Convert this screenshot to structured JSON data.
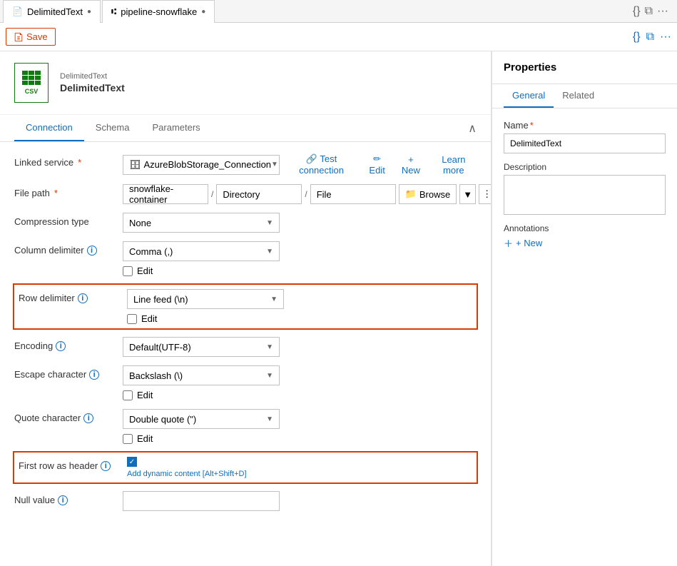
{
  "tabs": [
    {
      "id": "delimited-text",
      "label": "DelimitedText",
      "icon": "file-icon",
      "active": true
    },
    {
      "id": "pipeline-snowflake",
      "label": "pipeline-snowflake",
      "icon": "pipeline-icon",
      "active": false
    }
  ],
  "toolbar": {
    "save_label": "Save",
    "save_icon": "save-icon"
  },
  "dataset": {
    "type": "DelimitedText",
    "name": "DelimitedText"
  },
  "section_tabs": [
    {
      "id": "connection",
      "label": "Connection",
      "active": true
    },
    {
      "id": "schema",
      "label": "Schema",
      "active": false
    },
    {
      "id": "parameters",
      "label": "Parameters",
      "active": false
    }
  ],
  "form": {
    "linked_service_label": "Linked service",
    "linked_service_value": "AzureBlobStorage_Connection",
    "test_connection": "Test connection",
    "edit_label": "Edit",
    "new_label": "+ New",
    "learn_more": "Learn more",
    "file_path_label": "File path",
    "file_path_container": "snowflake-container",
    "file_path_directory": "Directory",
    "file_path_file": "File",
    "browse_label": "Browse",
    "compression_type_label": "Compression type",
    "compression_type_value": "None",
    "column_delimiter_label": "Column delimiter",
    "column_delimiter_info": "i",
    "column_delimiter_value": "Comma (,)",
    "column_edit_label": "Edit",
    "row_delimiter_label": "Row delimiter",
    "row_delimiter_info": "i",
    "row_delimiter_value": "Line feed (\\n)",
    "row_edit_label": "Edit",
    "encoding_label": "Encoding",
    "encoding_info": "i",
    "encoding_value": "Default(UTF-8)",
    "escape_character_label": "Escape character",
    "escape_character_info": "i",
    "escape_character_value": "Backslash (\\)",
    "escape_edit_label": "Edit",
    "quote_character_label": "Quote character",
    "quote_character_info": "i",
    "quote_character_value": "Double quote (\")",
    "quote_edit_label": "Edit",
    "first_row_header_label": "First row as header",
    "first_row_header_info": "i",
    "first_row_header_checked": true,
    "add_dynamic_content": "Add dynamic content [Alt+Shift+D]",
    "null_value_label": "Null value",
    "null_value_info": "i"
  },
  "properties": {
    "title": "Properties",
    "tabs": [
      {
        "id": "general",
        "label": "General",
        "active": true
      },
      {
        "id": "related",
        "label": "Related",
        "active": false
      }
    ],
    "name_label": "Name",
    "name_required": "*",
    "name_value": "DelimitedText",
    "description_label": "Description",
    "description_value": "",
    "annotations_label": "Annotations",
    "add_new_label": "+ New"
  }
}
